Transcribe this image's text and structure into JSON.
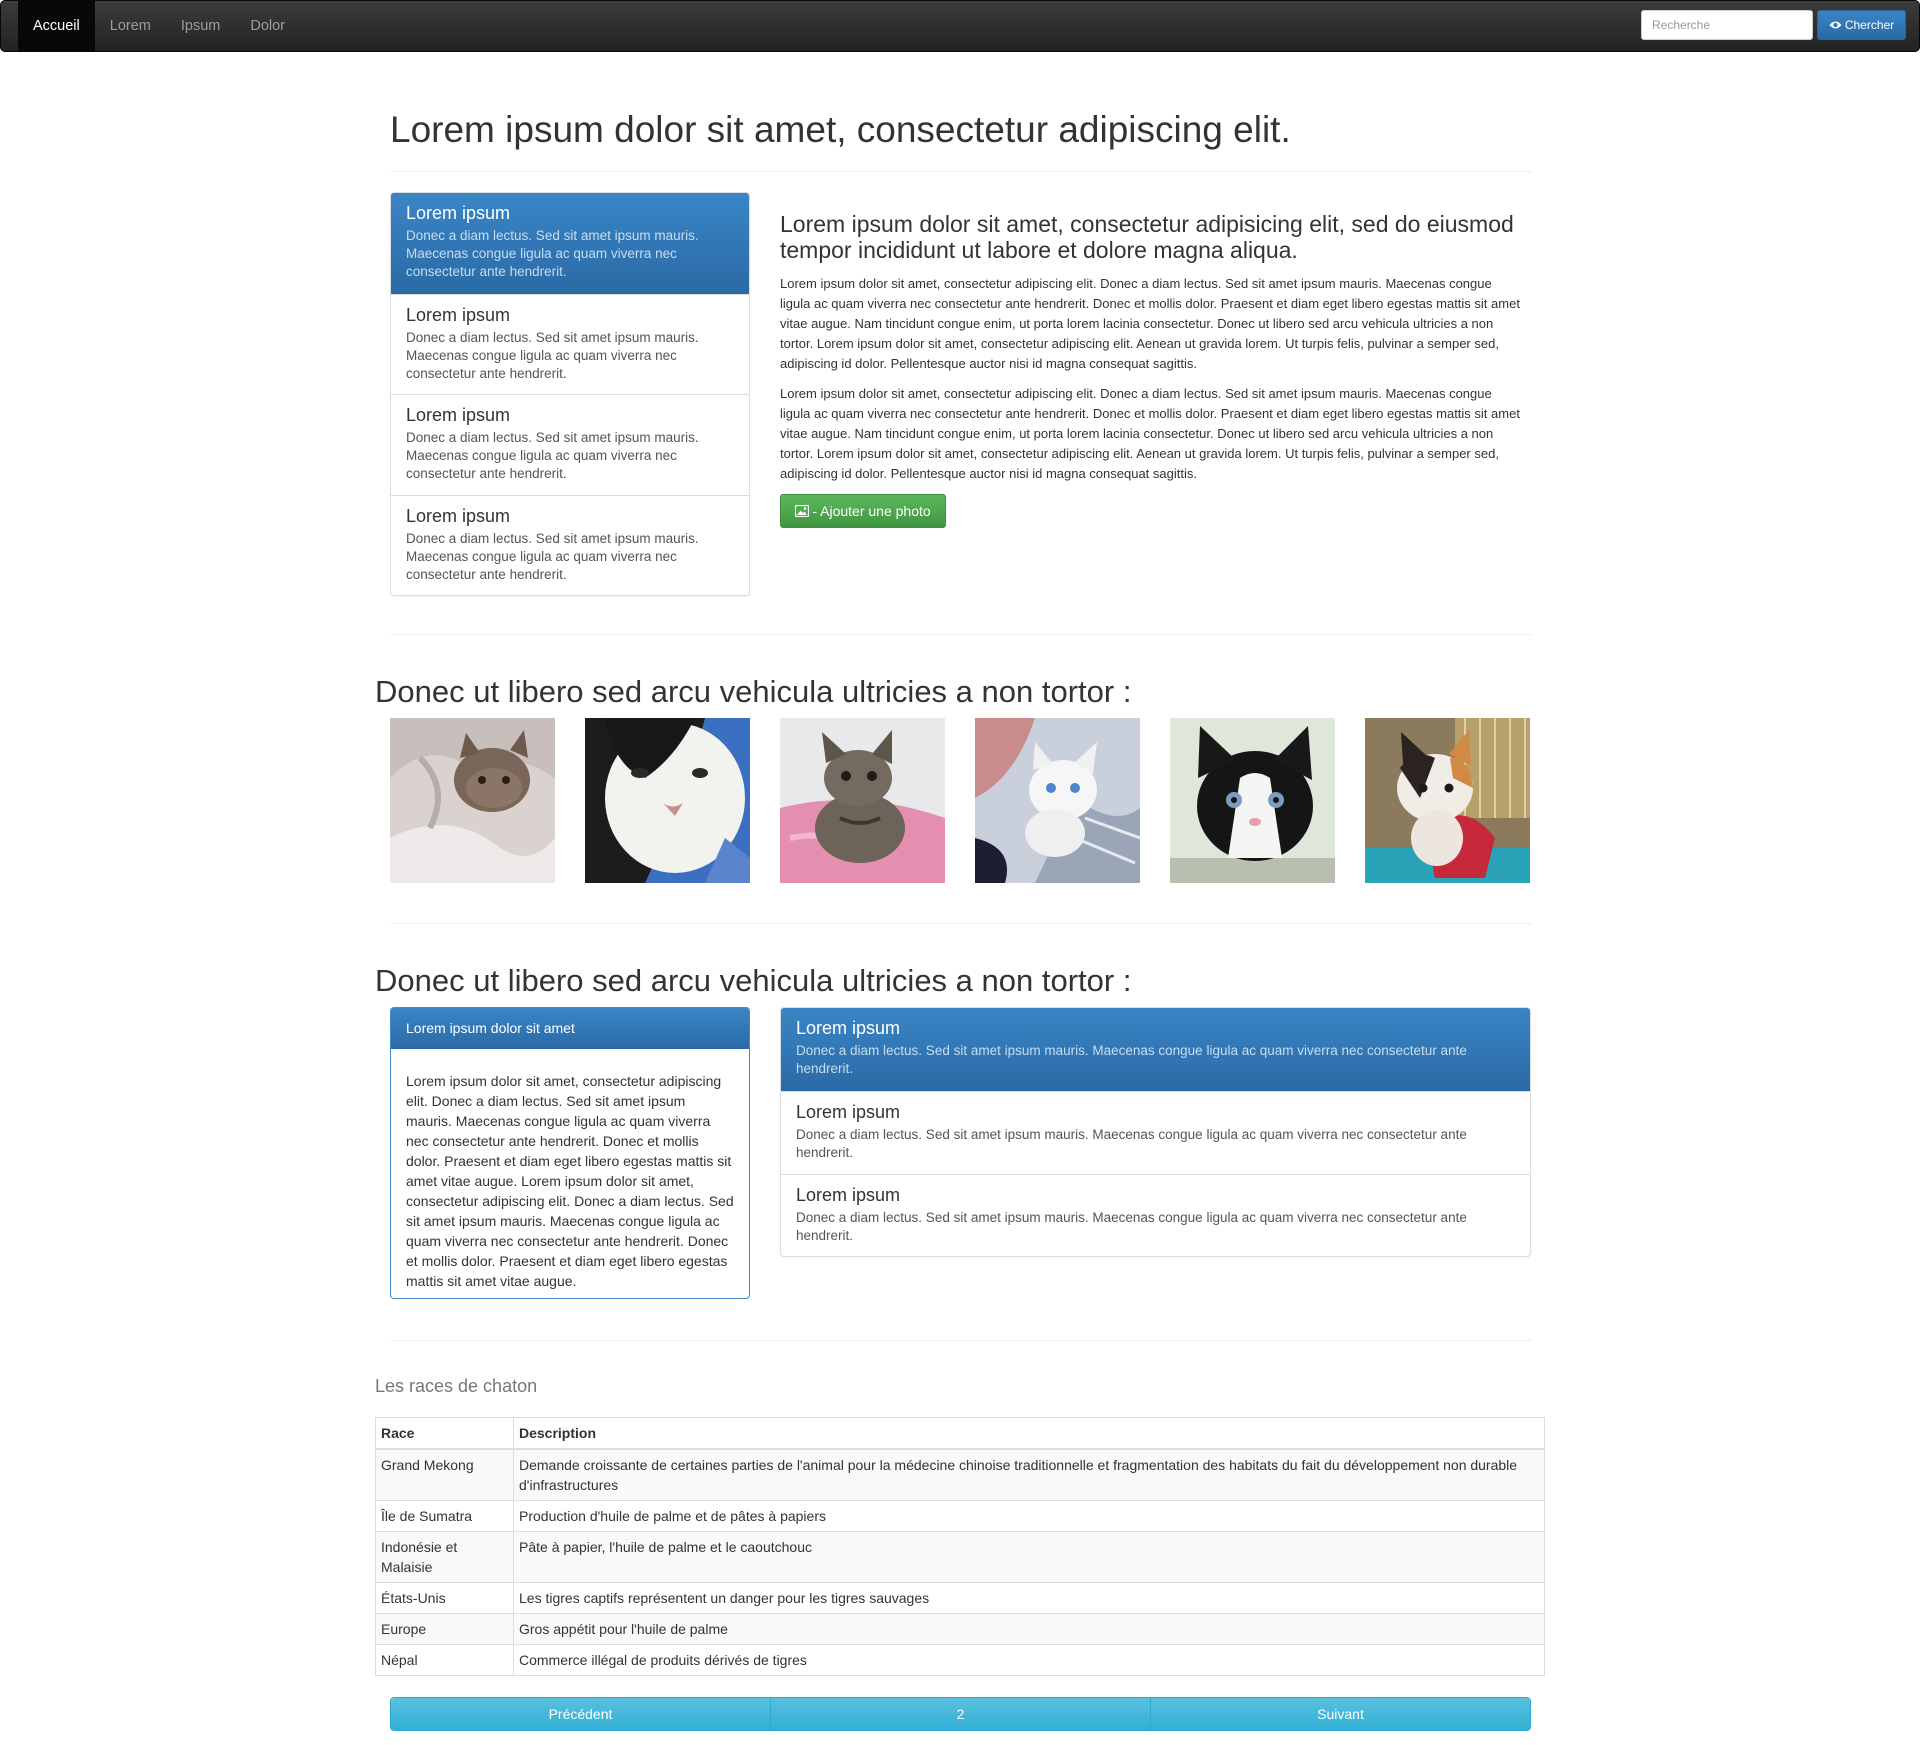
{
  "navbar": {
    "items": [
      {
        "label": "Accueil",
        "active": true
      },
      {
        "label": "Lorem"
      },
      {
        "label": "Ipsum"
      },
      {
        "label": "Dolor"
      }
    ],
    "search": {
      "placeholder": "Recherche",
      "value": "",
      "button_label": "Chercher",
      "button_icon": "eye-icon"
    }
  },
  "page_title": "Lorem ipsum dolor sit amet, consectetur adipiscing elit.",
  "intro": {
    "list": [
      {
        "heading": "Lorem ipsum",
        "text": "Donec a diam lectus. Sed sit amet ipsum mauris. Maecenas congue ligula ac quam viverra nec consectetur ante hendrerit.",
        "active": true
      },
      {
        "heading": "Lorem ipsum",
        "text": "Donec a diam lectus. Sed sit amet ipsum mauris. Maecenas congue ligula ac quam viverra nec consectetur ante hendrerit."
      },
      {
        "heading": "Lorem ipsum",
        "text": "Donec a diam lectus. Sed sit amet ipsum mauris. Maecenas congue ligula ac quam viverra nec consectetur ante hendrerit."
      },
      {
        "heading": "Lorem ipsum",
        "text": "Donec a diam lectus. Sed sit amet ipsum mauris. Maecenas congue ligula ac quam viverra nec consectetur ante hendrerit."
      }
    ],
    "lead_heading": "Lorem ipsum dolor sit amet, consectetur adipisicing elit, sed do eiusmod tempor incididunt ut labore et dolore magna aliqua.",
    "paragraphs": [
      "Lorem ipsum dolor sit amet, consectetur adipiscing elit. Donec a diam lectus. Sed sit amet ipsum mauris. Maecenas congue ligula ac quam viverra nec consectetur ante hendrerit. Donec et mollis dolor. Praesent et diam eget libero egestas mattis sit amet vitae augue. Nam tincidunt congue enim, ut porta lorem lacinia consectetur. Donec ut libero sed arcu vehicula ultricies a non tortor. Lorem ipsum dolor sit amet, consectetur adipiscing elit. Aenean ut gravida lorem. Ut turpis felis, pulvinar a semper sed, adipiscing id dolor. Pellentesque auctor nisi id magna consequat sagittis.",
      "Lorem ipsum dolor sit amet, consectetur adipiscing elit. Donec a diam lectus. Sed sit amet ipsum mauris. Maecenas congue ligula ac quam viverra nec consectetur ante hendrerit. Donec et mollis dolor. Praesent et diam eget libero egestas mattis sit amet vitae augue. Nam tincidunt congue enim, ut porta lorem lacinia consectetur. Donec ut libero sed arcu vehicula ultricies a non tortor. Lorem ipsum dolor sit amet, consectetur adipiscing elit. Aenean ut gravida lorem. Ut turpis felis, pulvinar a semper sed, adipiscing id dolor. Pellentesque auctor nisi id magna consequat sagittis."
    ],
    "photo_button_label": "- Ajouter une photo",
    "photo_button_icon": "picture-icon"
  },
  "gallery": {
    "title": "Donec ut libero sed arcu vehicula ultricies a non tortor :",
    "photos": [
      "kitten-photo-1",
      "kitten-photo-2",
      "kitten-photo-3",
      "kitten-photo-4",
      "kitten-photo-5",
      "kitten-photo-6"
    ]
  },
  "details": {
    "title": "Donec ut libero sed arcu vehicula ultricies a non tortor :",
    "panel": {
      "heading": "Lorem ipsum dolor sit amet",
      "body": "Lorem ipsum dolor sit amet, consectetur adipiscing elit. Donec a diam lectus. Sed sit amet ipsum mauris. Maecenas congue ligula ac quam viverra nec consectetur ante hendrerit. Donec et mollis dolor. Praesent et diam eget libero egestas mattis sit amet vitae augue. Lorem ipsum dolor sit amet, consectetur adipiscing elit. Donec a diam lectus. Sed sit amet ipsum mauris. Maecenas congue ligula ac quam viverra nec consectetur ante hendrerit. Donec et mollis dolor. Praesent et diam eget libero egestas mattis sit amet vitae augue."
    },
    "list": [
      {
        "heading": "Lorem ipsum",
        "text": "Donec a diam lectus. Sed sit amet ipsum mauris. Maecenas congue ligula ac quam viverra nec consectetur ante hendrerit.",
        "active": true
      },
      {
        "heading": "Lorem ipsum",
        "text": "Donec a diam lectus. Sed sit amet ipsum mauris. Maecenas congue ligula ac quam viverra nec consectetur ante hendrerit."
      },
      {
        "heading": "Lorem ipsum",
        "text": "Donec a diam lectus. Sed sit amet ipsum mauris. Maecenas congue ligula ac quam viverra nec consectetur ante hendrerit."
      }
    ]
  },
  "table": {
    "caption": "Les races de chaton",
    "headers": [
      "Race",
      "Description"
    ],
    "rows": [
      [
        "Grand Mekong",
        "Demande croissante de certaines parties de l'animal pour la médecine chinoise traditionnelle et fragmentation des habitats du fait du développement non durable d'infrastructures"
      ],
      [
        "Île de Sumatra",
        "Production d'huile de palme et de pâtes à papiers"
      ],
      [
        "Indonésie et Malaisie",
        "Pâte à papier, l'huile de palme et le caoutchouc"
      ],
      [
        "États-Unis",
        "Les tigres captifs représentent un danger pour les tigres sauvages"
      ],
      [
        "Europe",
        "Gros appétit pour l'huile de palme"
      ],
      [
        "Népal",
        "Commerce illégal de produits dérivés de tigres"
      ]
    ]
  },
  "pager": {
    "previous": "Précédent",
    "current": "2",
    "next": "Suivant"
  },
  "colors": {
    "primary": "#337ab7",
    "success": "#5cb85c",
    "info": "#5bc0de",
    "navbar": "#222222"
  }
}
